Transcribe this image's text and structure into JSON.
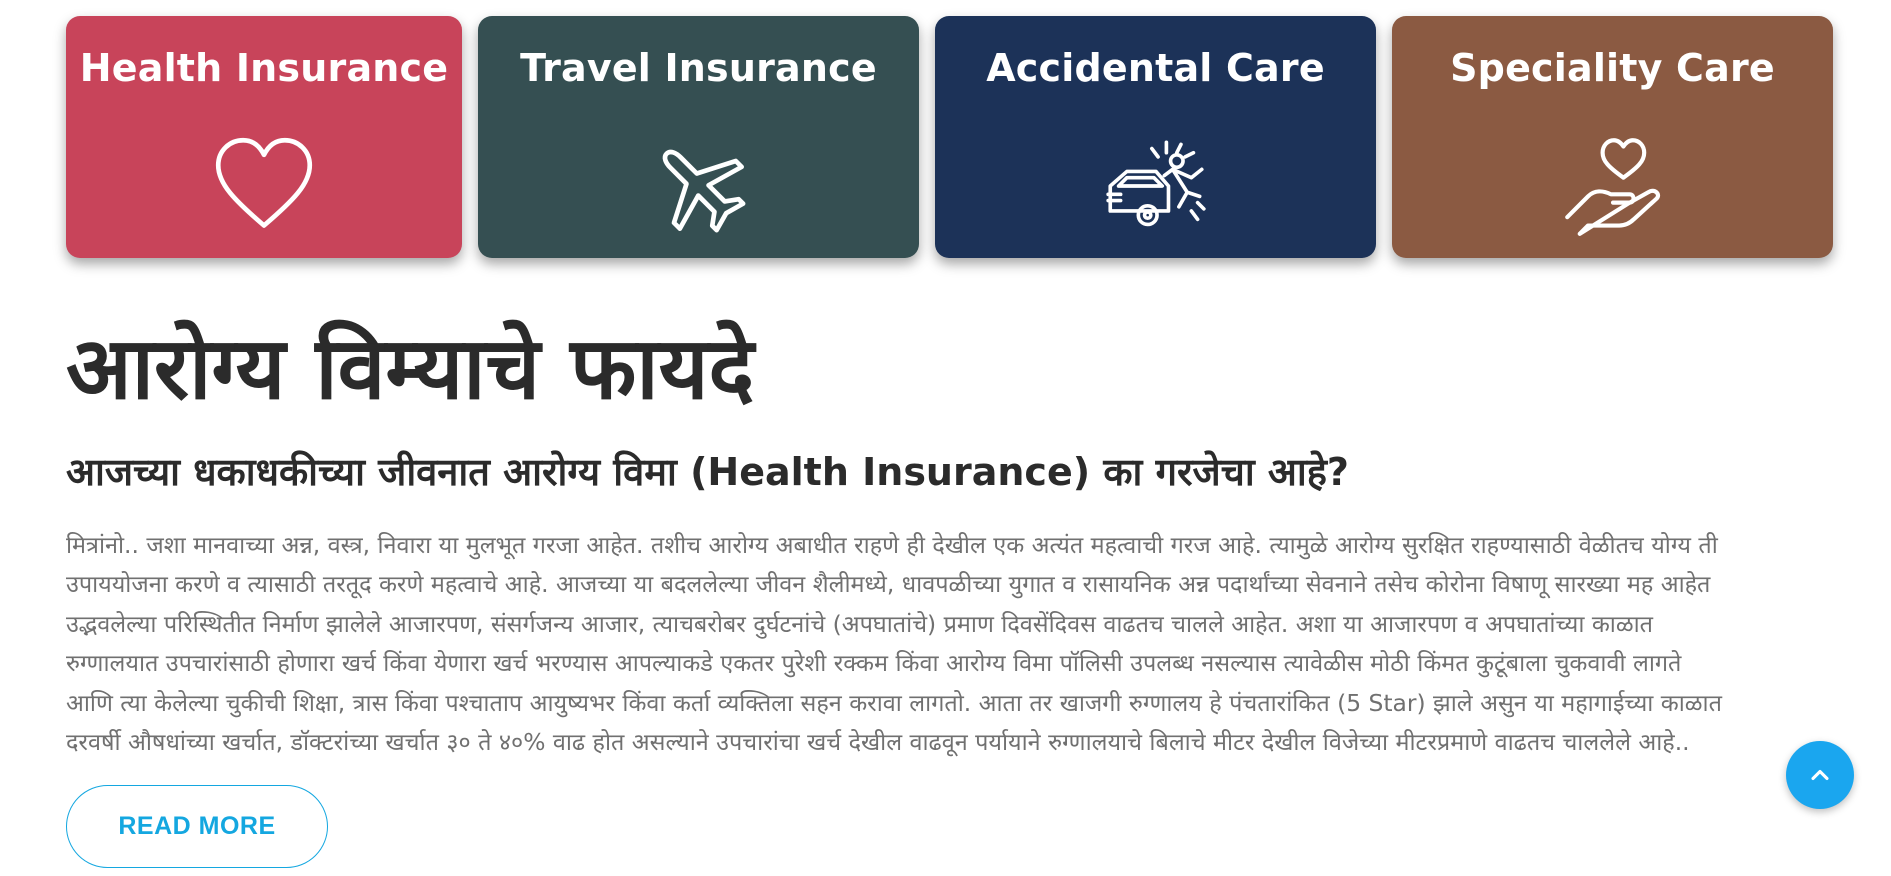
{
  "cards": [
    {
      "title": "Health Insurance",
      "icon": "heart-icon",
      "color": "#c8445a"
    },
    {
      "title": "Travel Insurance",
      "icon": "airplane-icon",
      "color": "#354f52"
    },
    {
      "title": "Accidental Care",
      "icon": "car-accident-icon",
      "color": "#1c3258"
    },
    {
      "title": "Speciality Care",
      "icon": "hand-heart-icon",
      "color": "#8b5a42"
    }
  ],
  "article": {
    "heading": "आरोग्य विम्याचे फायदे",
    "subheading": "आजच्या धकाधकीच्या जीवनात आरोग्य विमा (Health Insurance) का गरजेचा आहे?",
    "lines": [
      "मित्रांनो.. जशा मानवाच्या अन्न, वस्त्र, निवारा या मुलभूत गरजा आहेत. तशीच आरोग्य अबाधीत राहणे ही देखील एक अत्यंत महत्वाची गरज आहे. त्यामुळे आरोग्य सुरक्षित राहण्यासाठी वेळीतच योग्य ती",
      "उपाययोजना करणे व त्यासाठी तरतूद करणे महत्वाचे आहे. आजच्या या बदललेल्या जीवन शैलीमध्ये, धावपळीच्या युगात व रासायनिक अन्न पदार्थांच्या सेवनाने तसेच कोरोना विषाणू सारख्या मह आहेत",
      "उद्भवलेल्या परिस्थितीत निर्माण झालेले आजारपण, संसर्गजन्य आजार, त्याचबरोबर दुर्घटनांचे (अपघातांचे) प्रमाण दिवसेंदिवस वाढतच चालले आहेत. अशा या आजारपण व अपघातांच्या काळात",
      "रुग्णालयात उपचारांसाठी होणारा खर्च किंवा येणारा खर्च भरण्यास आपल्याकडे एकतर पुरेशी रक्कम किंवा आरोग्य विमा पॉलिसी उपलब्ध नसल्यास त्यावेळीस मोठी किंमत कुटूंबाला चुकवावी लागते",
      "आणि त्या केलेल्या चुकीची शिक्षा, त्रास किंवा पश्चाताप आयुष्यभर किंवा कर्ता व्यक्तिला सहन करावा लागतो. आता तर खाजगी रुग्णालय हे पंचतारांकित (5 Star) झाले असुन या महागाईच्या काळात",
      "दरवर्षी औषधांच्या खर्चात, डॉक्टरांच्या खर्चात ३० ते ४०% वाढ होत असल्याने उपचारांचा खर्च देखील वाढवून पर्यायाने रुग्णालयाचे बिलाचे मीटर देखील विजेच्या मीटरप्रमाणे वाढतच चाललेले आहे.."
    ],
    "read_more_label": "READ MORE"
  },
  "scroll_top": {
    "icon": "chevron-up-icon",
    "color": "#1aa6ef"
  }
}
